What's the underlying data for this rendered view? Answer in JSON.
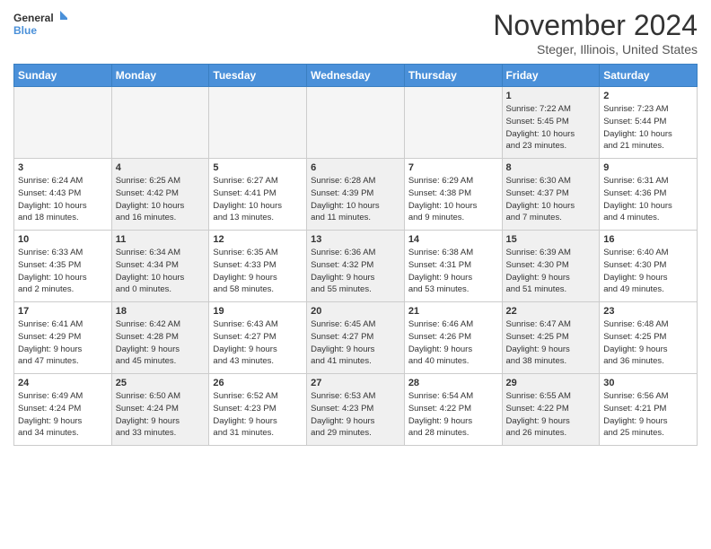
{
  "header": {
    "logo_line1": "General",
    "logo_line2": "Blue",
    "title": "November 2024",
    "location": "Steger, Illinois, United States"
  },
  "weekdays": [
    "Sunday",
    "Monday",
    "Tuesday",
    "Wednesday",
    "Thursday",
    "Friday",
    "Saturday"
  ],
  "weeks": [
    [
      {
        "day": "",
        "info": "",
        "empty": true
      },
      {
        "day": "",
        "info": "",
        "empty": true
      },
      {
        "day": "",
        "info": "",
        "empty": true
      },
      {
        "day": "",
        "info": "",
        "empty": true
      },
      {
        "day": "",
        "info": "",
        "empty": true
      },
      {
        "day": "1",
        "info": "Sunrise: 7:22 AM\nSunset: 5:45 PM\nDaylight: 10 hours\nand 23 minutes.",
        "shaded": true
      },
      {
        "day": "2",
        "info": "Sunrise: 7:23 AM\nSunset: 5:44 PM\nDaylight: 10 hours\nand 21 minutes.",
        "shaded": false
      }
    ],
    [
      {
        "day": "3",
        "info": "Sunrise: 6:24 AM\nSunset: 4:43 PM\nDaylight: 10 hours\nand 18 minutes.",
        "shaded": false
      },
      {
        "day": "4",
        "info": "Sunrise: 6:25 AM\nSunset: 4:42 PM\nDaylight: 10 hours\nand 16 minutes.",
        "shaded": true
      },
      {
        "day": "5",
        "info": "Sunrise: 6:27 AM\nSunset: 4:41 PM\nDaylight: 10 hours\nand 13 minutes.",
        "shaded": false
      },
      {
        "day": "6",
        "info": "Sunrise: 6:28 AM\nSunset: 4:39 PM\nDaylight: 10 hours\nand 11 minutes.",
        "shaded": true
      },
      {
        "day": "7",
        "info": "Sunrise: 6:29 AM\nSunset: 4:38 PM\nDaylight: 10 hours\nand 9 minutes.",
        "shaded": false
      },
      {
        "day": "8",
        "info": "Sunrise: 6:30 AM\nSunset: 4:37 PM\nDaylight: 10 hours\nand 7 minutes.",
        "shaded": true
      },
      {
        "day": "9",
        "info": "Sunrise: 6:31 AM\nSunset: 4:36 PM\nDaylight: 10 hours\nand 4 minutes.",
        "shaded": false
      }
    ],
    [
      {
        "day": "10",
        "info": "Sunrise: 6:33 AM\nSunset: 4:35 PM\nDaylight: 10 hours\nand 2 minutes.",
        "shaded": false
      },
      {
        "day": "11",
        "info": "Sunrise: 6:34 AM\nSunset: 4:34 PM\nDaylight: 10 hours\nand 0 minutes.",
        "shaded": true
      },
      {
        "day": "12",
        "info": "Sunrise: 6:35 AM\nSunset: 4:33 PM\nDaylight: 9 hours\nand 58 minutes.",
        "shaded": false
      },
      {
        "day": "13",
        "info": "Sunrise: 6:36 AM\nSunset: 4:32 PM\nDaylight: 9 hours\nand 55 minutes.",
        "shaded": true
      },
      {
        "day": "14",
        "info": "Sunrise: 6:38 AM\nSunset: 4:31 PM\nDaylight: 9 hours\nand 53 minutes.",
        "shaded": false
      },
      {
        "day": "15",
        "info": "Sunrise: 6:39 AM\nSunset: 4:30 PM\nDaylight: 9 hours\nand 51 minutes.",
        "shaded": true
      },
      {
        "day": "16",
        "info": "Sunrise: 6:40 AM\nSunset: 4:30 PM\nDaylight: 9 hours\nand 49 minutes.",
        "shaded": false
      }
    ],
    [
      {
        "day": "17",
        "info": "Sunrise: 6:41 AM\nSunset: 4:29 PM\nDaylight: 9 hours\nand 47 minutes.",
        "shaded": false
      },
      {
        "day": "18",
        "info": "Sunrise: 6:42 AM\nSunset: 4:28 PM\nDaylight: 9 hours\nand 45 minutes.",
        "shaded": true
      },
      {
        "day": "19",
        "info": "Sunrise: 6:43 AM\nSunset: 4:27 PM\nDaylight: 9 hours\nand 43 minutes.",
        "shaded": false
      },
      {
        "day": "20",
        "info": "Sunrise: 6:45 AM\nSunset: 4:27 PM\nDaylight: 9 hours\nand 41 minutes.",
        "shaded": true
      },
      {
        "day": "21",
        "info": "Sunrise: 6:46 AM\nSunset: 4:26 PM\nDaylight: 9 hours\nand 40 minutes.",
        "shaded": false
      },
      {
        "day": "22",
        "info": "Sunrise: 6:47 AM\nSunset: 4:25 PM\nDaylight: 9 hours\nand 38 minutes.",
        "shaded": true
      },
      {
        "day": "23",
        "info": "Sunrise: 6:48 AM\nSunset: 4:25 PM\nDaylight: 9 hours\nand 36 minutes.",
        "shaded": false
      }
    ],
    [
      {
        "day": "24",
        "info": "Sunrise: 6:49 AM\nSunset: 4:24 PM\nDaylight: 9 hours\nand 34 minutes.",
        "shaded": false
      },
      {
        "day": "25",
        "info": "Sunrise: 6:50 AM\nSunset: 4:24 PM\nDaylight: 9 hours\nand 33 minutes.",
        "shaded": true
      },
      {
        "day": "26",
        "info": "Sunrise: 6:52 AM\nSunset: 4:23 PM\nDaylight: 9 hours\nand 31 minutes.",
        "shaded": false
      },
      {
        "day": "27",
        "info": "Sunrise: 6:53 AM\nSunset: 4:23 PM\nDaylight: 9 hours\nand 29 minutes.",
        "shaded": true
      },
      {
        "day": "28",
        "info": "Sunrise: 6:54 AM\nSunset: 4:22 PM\nDaylight: 9 hours\nand 28 minutes.",
        "shaded": false
      },
      {
        "day": "29",
        "info": "Sunrise: 6:55 AM\nSunset: 4:22 PM\nDaylight: 9 hours\nand 26 minutes.",
        "shaded": true
      },
      {
        "day": "30",
        "info": "Sunrise: 6:56 AM\nSunset: 4:21 PM\nDaylight: 9 hours\nand 25 minutes.",
        "shaded": false
      }
    ]
  ]
}
